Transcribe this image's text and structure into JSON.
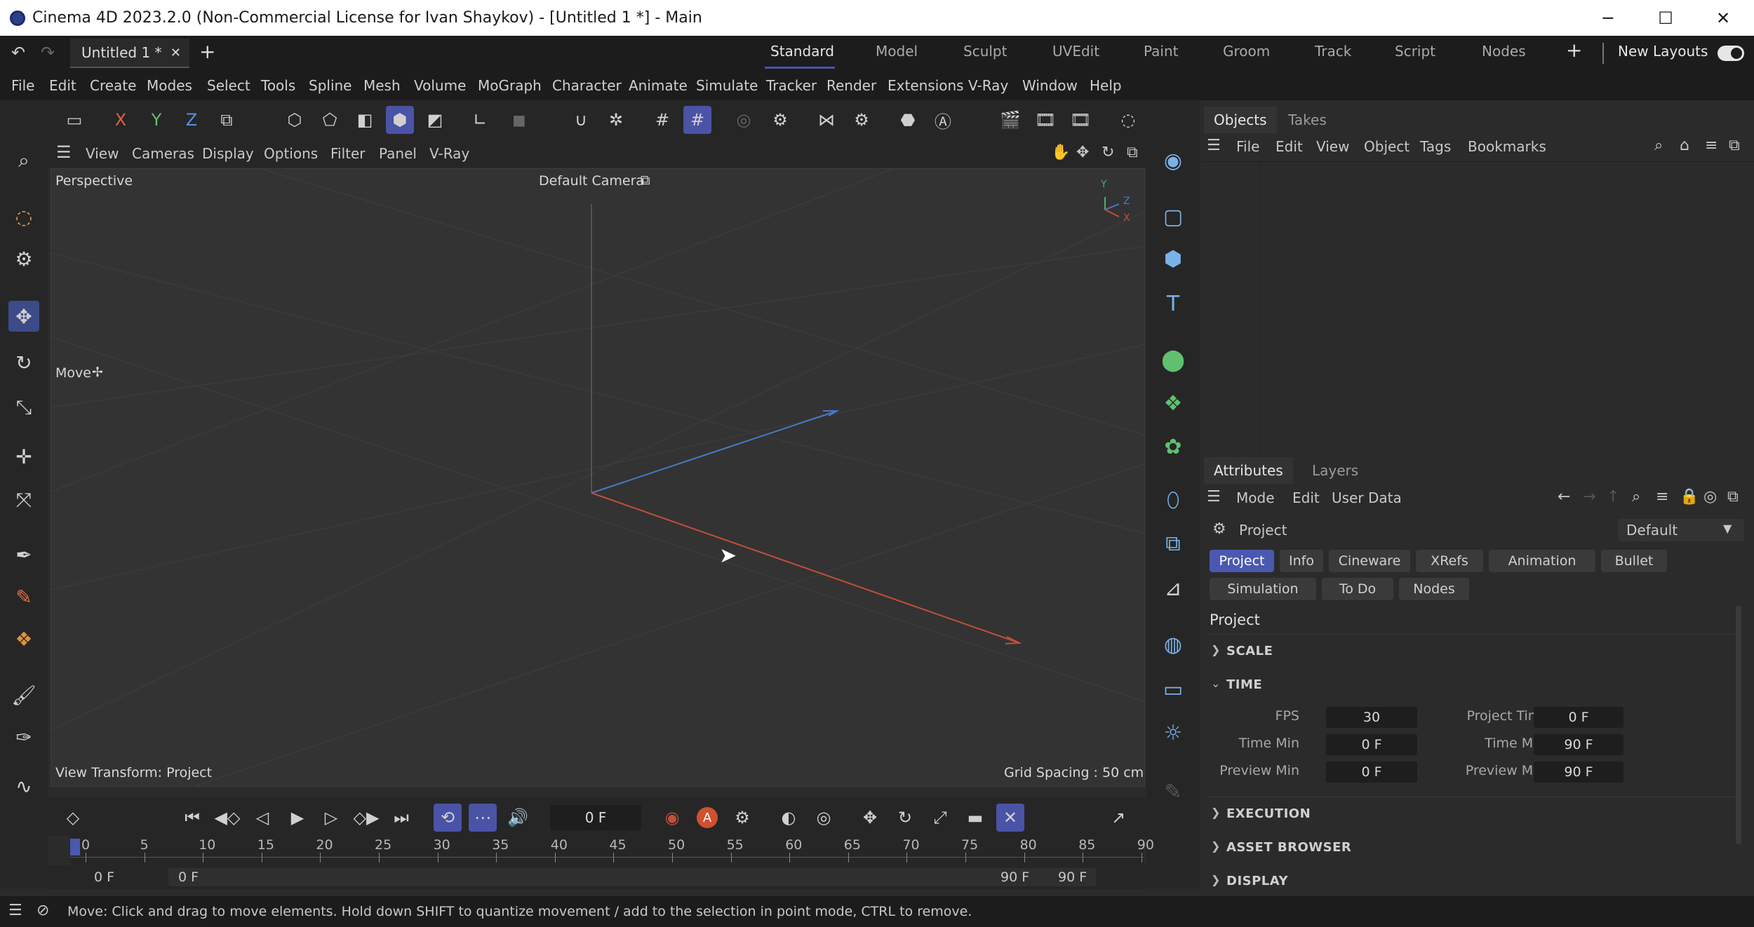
{
  "window": {
    "title": "Cinema 4D 2023.2.0 (Non-Commercial License for Ivan Shaykov) - [Untitled 1 *] - Main",
    "minimize": "─",
    "maximize": "☐",
    "close": "✕"
  },
  "doc_tab": {
    "label": "Untitled 1 *",
    "close": "✕",
    "add": "+"
  },
  "layouts": {
    "items": [
      "Standard",
      "Model",
      "Sculpt",
      "UVEdit",
      "Paint",
      "Groom",
      "Track",
      "Script",
      "Nodes"
    ],
    "add": "+",
    "new_layouts": "New Layouts"
  },
  "menu": [
    "File",
    "Edit",
    "Create",
    "Modes",
    "Select",
    "Tools",
    "Spline",
    "Mesh",
    "Volume",
    "MoGraph",
    "Character",
    "Animate",
    "Simulate",
    "Tracker",
    "Render",
    "Extensions",
    "V-Ray",
    "Window",
    "Help"
  ],
  "toolbar": {
    "x": "X",
    "y": "Y",
    "z": "Z"
  },
  "viewport_menu": [
    "View",
    "Cameras",
    "Display",
    "Options",
    "Filter",
    "Panel",
    "V-Ray"
  ],
  "viewport": {
    "perspective": "Perspective",
    "camera": "Default Camera",
    "tool_hint": "Move",
    "view_transform": "View Transform: Project",
    "grid_spacing": "Grid Spacing : 50 cm",
    "axis_y": "Y",
    "axis_z": "Z",
    "axis_x": "X"
  },
  "transport": {
    "current_frame": "0 F",
    "auto_key": "A"
  },
  "ruler": {
    "ticks": [
      "0",
      "5",
      "10",
      "15",
      "20",
      "25",
      "30",
      "35",
      "40",
      "45",
      "50",
      "55",
      "60",
      "65",
      "70",
      "75",
      "80",
      "85",
      "90"
    ]
  },
  "range": {
    "start": "0 F",
    "range_start": "0 F",
    "range_end": "90 F",
    "end": "90 F"
  },
  "status": {
    "message": "Move: Click and drag to move elements. Hold down SHIFT to quantize movement / add to the selection in point mode, CTRL to remove."
  },
  "objects_panel": {
    "tabs": [
      "Objects",
      "Takes"
    ],
    "menu": [
      "File",
      "Edit",
      "View",
      "Object",
      "Tags",
      "Bookmarks"
    ]
  },
  "attributes_panel": {
    "tabs": [
      "Attributes",
      "Layers"
    ],
    "menu": [
      "Mode",
      "Edit",
      "User Data"
    ],
    "object_name": "Project",
    "preset": "Default",
    "pills_row1": [
      "Project",
      "Info",
      "Cineware",
      "XRefs",
      "Animation",
      "Bullet"
    ],
    "pills_row2": [
      "Simulation",
      "To Do",
      "Nodes"
    ],
    "heading": "Project",
    "sections": {
      "scale": "SCALE",
      "time": "TIME",
      "execution": "EXECUTION",
      "asset_browser": "ASSET BROWSER",
      "display": "DISPLAY"
    },
    "time_fields": {
      "fps_label": "FPS",
      "fps": "30",
      "project_time_label": "Project Time",
      "project_time": "0 F",
      "time_min_label": "Time Min",
      "time_min": "0 F",
      "time_max_label": "Time Max",
      "time_max": "90 F",
      "preview_min_label": "Preview Min",
      "preview_min": "0 F",
      "preview_max_label": "Preview Max",
      "preview_max": "90 F"
    }
  },
  "colors": {
    "accent": "#4a53a6",
    "axis_x": "#c0503a",
    "axis_y": "#4caf6e",
    "axis_z": "#4a78c8"
  }
}
